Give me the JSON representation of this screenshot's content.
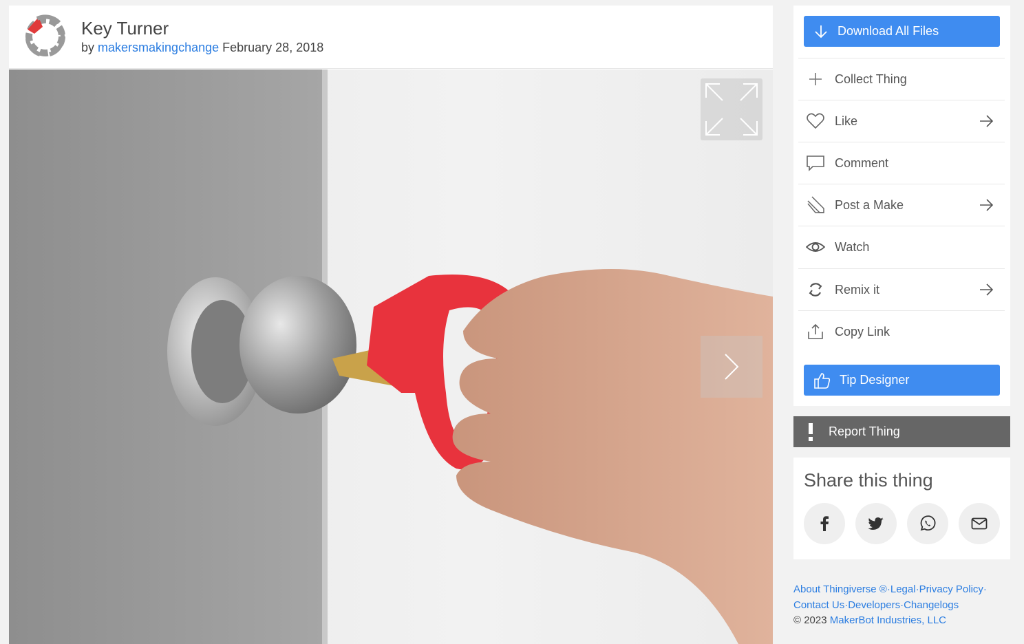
{
  "header": {
    "title": "Key Turner",
    "by_prefix": "by",
    "author": "makersmakingchange",
    "date": "February 28, 2018"
  },
  "actions": {
    "download_label": "Download All Files",
    "items": [
      {
        "label": "Collect Thing",
        "icon": "plus-icon",
        "has_arrow": false
      },
      {
        "label": "Like",
        "icon": "heart-icon",
        "has_arrow": true
      },
      {
        "label": "Comment",
        "icon": "comment-icon",
        "has_arrow": false
      },
      {
        "label": "Post a Make",
        "icon": "make-icon",
        "has_arrow": true
      },
      {
        "label": "Watch",
        "icon": "eye-icon",
        "has_arrow": false
      },
      {
        "label": "Remix it",
        "icon": "remix-icon",
        "has_arrow": true
      },
      {
        "label": "Copy Link",
        "icon": "share-upload-icon",
        "has_arrow": false
      }
    ],
    "tip_label": "Tip Designer"
  },
  "report": {
    "label": "Report Thing"
  },
  "share": {
    "title": "Share this thing",
    "buttons": [
      "facebook-icon",
      "twitter-icon",
      "whatsapp-icon",
      "email-icon"
    ]
  },
  "footer": {
    "links_line1": [
      "About Thingiverse ®",
      "Legal",
      "Privacy Policy"
    ],
    "links_line2": [
      "Contact Us",
      "Developers",
      "Changelogs"
    ],
    "copyright_prefix": "©  2023",
    "company": "MakerBot Industries, LLC"
  },
  "colors": {
    "accent": "#3f8cf0",
    "link": "#2b7de1",
    "report": "#666666",
    "key_turner": "#e8333d"
  }
}
